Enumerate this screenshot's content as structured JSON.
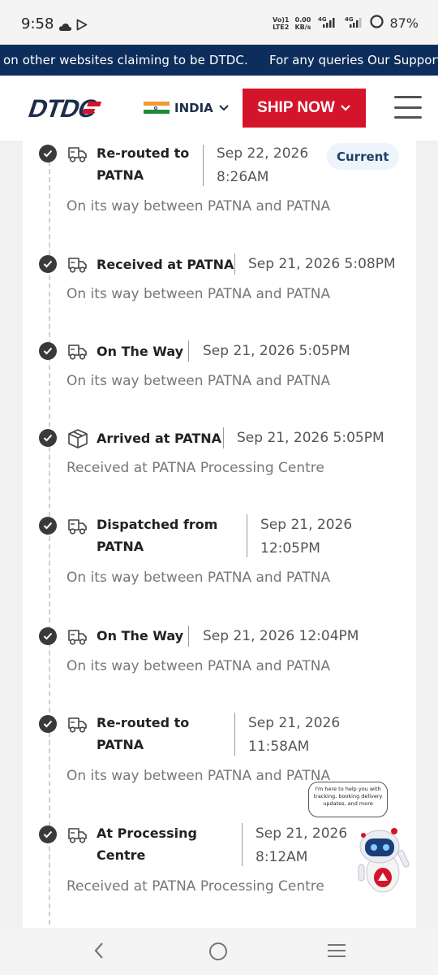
{
  "status_bar": {
    "time": "9:58",
    "volte": "Vo) 1\nLTE2",
    "speed": "0.00\nKB/s",
    "net1": "4G",
    "net2": "4G",
    "battery": "87%"
  },
  "ticker": {
    "text1": "on other websites claiming to be DTDC.",
    "text2": "For any queries Our Support"
  },
  "header": {
    "logo_text": "DTDC",
    "country": "INDIA",
    "ship_now": "SHIP NOW",
    "colors": {
      "brand_red": "#d4142a",
      "brand_navy": "#1c2e4a"
    }
  },
  "events": [
    {
      "title_lines": [
        "Re-routed to",
        "PATNA"
      ],
      "date_lines": [
        "Sep 22, 2026",
        "8:26AM"
      ],
      "description": "On its way between PATNA and PATNA",
      "icon": "truck-icon",
      "current_label": "Current"
    },
    {
      "title_lines": [
        "Received at PATNA"
      ],
      "date_lines": [
        "Sep 21, 2026 5:08PM"
      ],
      "description": "On its way between PATNA and PATNA",
      "icon": "truck-icon"
    },
    {
      "title_lines": [
        "On The Way"
      ],
      "date_lines": [
        "Sep 21, 2026 5:05PM"
      ],
      "description": "On its way between PATNA and PATNA",
      "icon": "truck-icon"
    },
    {
      "title_lines": [
        "Arrived at PATNA"
      ],
      "date_lines": [
        "Sep 21, 2026 5:05PM"
      ],
      "description": "Received at PATNA Processing Centre",
      "icon": "package-icon"
    },
    {
      "title_lines": [
        "Dispatched from",
        "PATNA"
      ],
      "date_lines": [
        "Sep 21, 2026",
        "12:05PM"
      ],
      "description": "On its way between PATNA and PATNA",
      "icon": "truck-icon"
    },
    {
      "title_lines": [
        "On The Way"
      ],
      "date_lines": [
        "Sep 21, 2026 12:04PM"
      ],
      "description": "On its way between PATNA and PATNA",
      "icon": "truck-icon"
    },
    {
      "title_lines": [
        "Re-routed to",
        "PATNA"
      ],
      "date_lines": [
        "Sep 21, 2026",
        "11:58AM"
      ],
      "description": "On its way between PATNA and PATNA",
      "icon": "truck-icon"
    },
    {
      "title_lines": [
        "At Processing",
        "Centre"
      ],
      "date_lines": [
        "Sep 21, 2026",
        "8:12AM"
      ],
      "description": "Received at PATNA Processing Centre",
      "icon": "truck-icon"
    }
  ],
  "chatbot": {
    "bubble_text": "I'm here to help you with tracking, booking delivery updates, and more"
  }
}
